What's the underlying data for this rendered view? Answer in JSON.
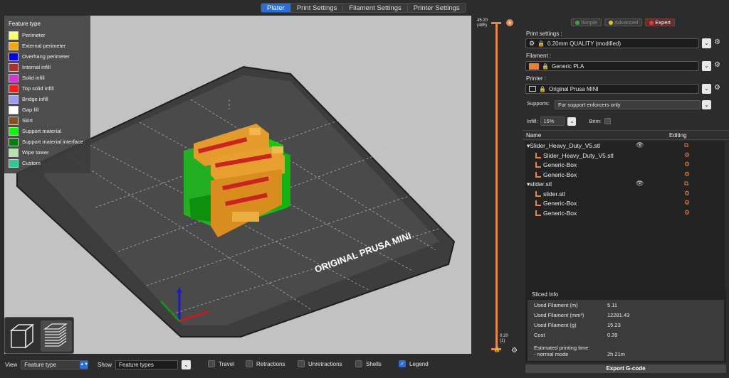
{
  "tabs": [
    "Plater",
    "Print Settings",
    "Filament Settings",
    "Printer Settings"
  ],
  "legend": {
    "title": "Feature type",
    "items": [
      {
        "label": "Perimeter",
        "color": "#ffff66"
      },
      {
        "label": "External perimeter",
        "color": "#ffa500"
      },
      {
        "label": "Overhang perimeter",
        "color": "#0000ff"
      },
      {
        "label": "Internal infill",
        "color": "#b03029"
      },
      {
        "label": "Solid infill",
        "color": "#d732d7"
      },
      {
        "label": "Top solid infill",
        "color": "#ff1a1a"
      },
      {
        "label": "Bridge infill",
        "color": "#9999ff"
      },
      {
        "label": "Gap fill",
        "color": "#ffffff"
      },
      {
        "label": "Skirt",
        "color": "#845321"
      },
      {
        "label": "Support material",
        "color": "#00ff00"
      },
      {
        "label": "Support material interface",
        "color": "#008000"
      },
      {
        "label": "Wipe tower",
        "color": "#b3e3ab"
      },
      {
        "label": "Custom",
        "color": "#28cc94"
      }
    ]
  },
  "bed": {
    "label": "ORIGINAL PRUSA MINI"
  },
  "slider": {
    "top_label": "45.20",
    "top_sub": "(485)",
    "bottom_label": "0.20",
    "bottom_sub": "(1)"
  },
  "modes": {
    "simple": "Simple",
    "advanced": "Advanced",
    "expert": "Expert"
  },
  "print_settings": {
    "label": "Print settings :",
    "value": "0.20mm QUALITY (modified)"
  },
  "filament": {
    "label": "Filament :",
    "value": "Generic PLA",
    "color": "#f0812a"
  },
  "printer": {
    "label": "Printer :",
    "value": "Original Prusa MINI"
  },
  "supports": {
    "label": "Supports:",
    "value": "For support enforcers only"
  },
  "infill": {
    "label": "Infill:",
    "value": "15%"
  },
  "brim": {
    "label": "Brim:"
  },
  "object_list": {
    "col_name": "Name",
    "col_editing": "Editing",
    "rows": [
      {
        "name": "Slider_Heavy_Duty_V5.stl",
        "level": 0
      },
      {
        "name": "Slider_Heavy_Duty_V5.stl",
        "level": 1
      },
      {
        "name": "Generic-Box",
        "level": 1
      },
      {
        "name": "Generic-Box",
        "level": 1
      },
      {
        "name": "slider.stl",
        "level": 0
      },
      {
        "name": "slider.stl",
        "level": 1
      },
      {
        "name": "Generic-Box",
        "level": 1
      },
      {
        "name": "Generic-Box",
        "level": 1
      }
    ]
  },
  "sliced_info": {
    "title": "Sliced Info",
    "rows": [
      {
        "label": "Used Filament (m)",
        "value": "5.11"
      },
      {
        "label": "Used Filament (mm³)",
        "value": "12281.43"
      },
      {
        "label": "Used Filament (g)",
        "value": "15.23"
      },
      {
        "label": "Cost",
        "value": "0.39"
      },
      {
        "label": "Estimated printing time:",
        "value": ""
      },
      {
        "label": "- normal mode",
        "value": "2h 21m"
      }
    ]
  },
  "export_button": "Export G-code",
  "bottom_bar": {
    "view_label": "View",
    "view_value": "Feature type",
    "show_label": "Show",
    "show_value": "Feature types",
    "checkboxes": [
      {
        "label": "Travel",
        "checked": false
      },
      {
        "label": "Retractions",
        "checked": false
      },
      {
        "label": "Unretractions",
        "checked": false
      },
      {
        "label": "Shells",
        "checked": false
      },
      {
        "label": "Legend",
        "checked": true
      }
    ]
  }
}
